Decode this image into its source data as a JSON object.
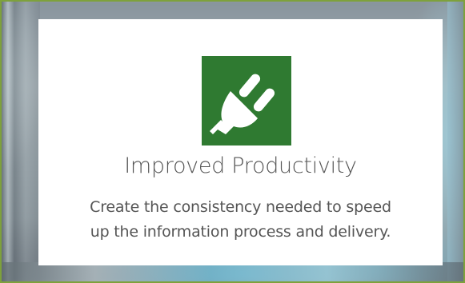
{
  "card": {
    "icon": "plug-icon",
    "title": "Improved Productivity",
    "description_line1": "Create the consistency needed to speed",
    "description_line2": "up the information process and delivery."
  },
  "colors": {
    "icon_background": "#2f7a31",
    "frame_border": "#7ea13c",
    "text": "#555555"
  }
}
